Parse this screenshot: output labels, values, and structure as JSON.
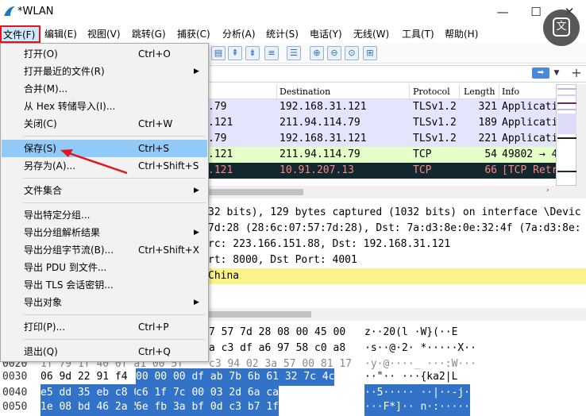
{
  "window": {
    "title": "*WLAN",
    "minimize": "—",
    "maximize": "☐",
    "close": "✕"
  },
  "overlay": {
    "icon_text": "文"
  },
  "menubar": {
    "items": [
      "文件(F)",
      "编辑(E)",
      "视图(V)",
      "跳转(G)",
      "捕获(C)",
      "分析(A)",
      "统计(S)",
      "电话(Y)",
      "无线(W)",
      "工具(T)",
      "帮助(H)"
    ]
  },
  "file_menu": {
    "items": [
      {
        "label": "打开(O)",
        "shortcut": "Ctrl+O",
        "submenu": false
      },
      {
        "label": "打开最近的文件(R)",
        "shortcut": "",
        "submenu": true
      },
      {
        "label": "合并(M)...",
        "shortcut": "",
        "submenu": false
      },
      {
        "label": "从 Hex 转储导入(I)...",
        "shortcut": "",
        "submenu": false
      },
      {
        "label": "关闭(C)",
        "shortcut": "Ctrl+W",
        "submenu": false
      },
      {
        "label": "保存(S)",
        "shortcut": "Ctrl+S",
        "submenu": false
      },
      {
        "label": "另存为(A)...",
        "shortcut": "Ctrl+Shift+S",
        "submenu": false
      },
      {
        "label": "文件集合",
        "shortcut": "",
        "submenu": true
      },
      {
        "label": "导出特定分组...",
        "shortcut": "",
        "submenu": false
      },
      {
        "label": "导出分组解析结果",
        "shortcut": "",
        "submenu": true
      },
      {
        "label": "导出分组字节流(B)...",
        "shortcut": "Ctrl+Shift+X",
        "submenu": false
      },
      {
        "label": "导出 PDU 到文件...",
        "shortcut": "",
        "submenu": false
      },
      {
        "label": "导出 TLS 会话密钥...",
        "shortcut": "",
        "submenu": false
      },
      {
        "label": "导出对象",
        "shortcut": "",
        "submenu": true
      },
      {
        "label": "打印(P)...",
        "shortcut": "Ctrl+P",
        "submenu": false
      },
      {
        "label": "退出(Q)",
        "shortcut": "Ctrl+Q",
        "submenu": false
      }
    ],
    "submenu_arrow": "▶"
  },
  "filter": {
    "apply_icon": "➡",
    "dropdown_icon": "▼",
    "add_icon": "+"
  },
  "packet_list": {
    "headers": [
      "Destination",
      "Protocol",
      "Length",
      "Info"
    ],
    "rows": [
      {
        "src": ".79",
        "dst": "192.168.31.121",
        "proto": "TLSv1.2",
        "len": "321",
        "info": "Applicati",
        "style": "tls"
      },
      {
        "src": ".121",
        "dst": "211.94.114.79",
        "proto": "TLSv1.2",
        "len": "189",
        "info": "Applicati",
        "style": "tls"
      },
      {
        "src": ".79",
        "dst": "192.168.31.121",
        "proto": "TLSv1.2",
        "len": "221",
        "info": "Applicati",
        "style": "tls"
      },
      {
        "src": ".121",
        "dst": "211.94.114.79",
        "proto": "TCP",
        "len": "54",
        "info": "49802 → 4",
        "style": "tcp"
      },
      {
        "src": ".121",
        "dst": "10.91.207.13",
        "proto": "TCP",
        "len": "66",
        "info": "[TCP Retr",
        "style": "sel"
      }
    ]
  },
  "details": {
    "lines": [
      "32 bits), 129 bytes captured (1032 bits) on interface \\Devic",
      "7d:28 (28:6c:07:57:7d:28), Dst: 7a:d3:8e:0e:32:4f (7a:d3:8e:",
      "rc: 223.166.151.88, Dst: 192.168.31.121",
      "rt: 8000, Dst Port: 4001",
      "China"
    ]
  },
  "hex": {
    "rows": [
      {
        "offset": "",
        "a": "",
        "b": "7 57 7d 28 08 00 45 00",
        "ascii": "z··20(l ·W}(··E"
      },
      {
        "offset": "",
        "a": "",
        "b": "a c3 df a6 97 58 c0 a8",
        "ascii": "·s··@·2· *·····X··"
      },
      {
        "offset": "0020",
        "a": "1f 79 1f 40 0f a1 00 5f",
        "b": "c3 94 02 3a 57 00 81 17",
        "ascii": "·y·@····_ ···:W···"
      },
      {
        "offset": "0030",
        "a": "06 9d 22 91 f4",
        "b": "00 00 00  df ab 7b 6b 61 32 7c 4c",
        "ascii": "··\"·· ···{ka2|L"
      },
      {
        "offset": "0040",
        "a": "e5 dd 35 eb c8 01 85 95",
        "b": "c6 1f 7c 00 03 2d 6a ca",
        "ascii": "··5····· ··|··-j·"
      },
      {
        "offset": "0050",
        "a": "1e 08 bd 46 2a 5d 1f ba",
        "b": "6e fb 3a bf 0d c3 b7 1f",
        "ascii": "···F*]·· n·:·····"
      }
    ]
  }
}
